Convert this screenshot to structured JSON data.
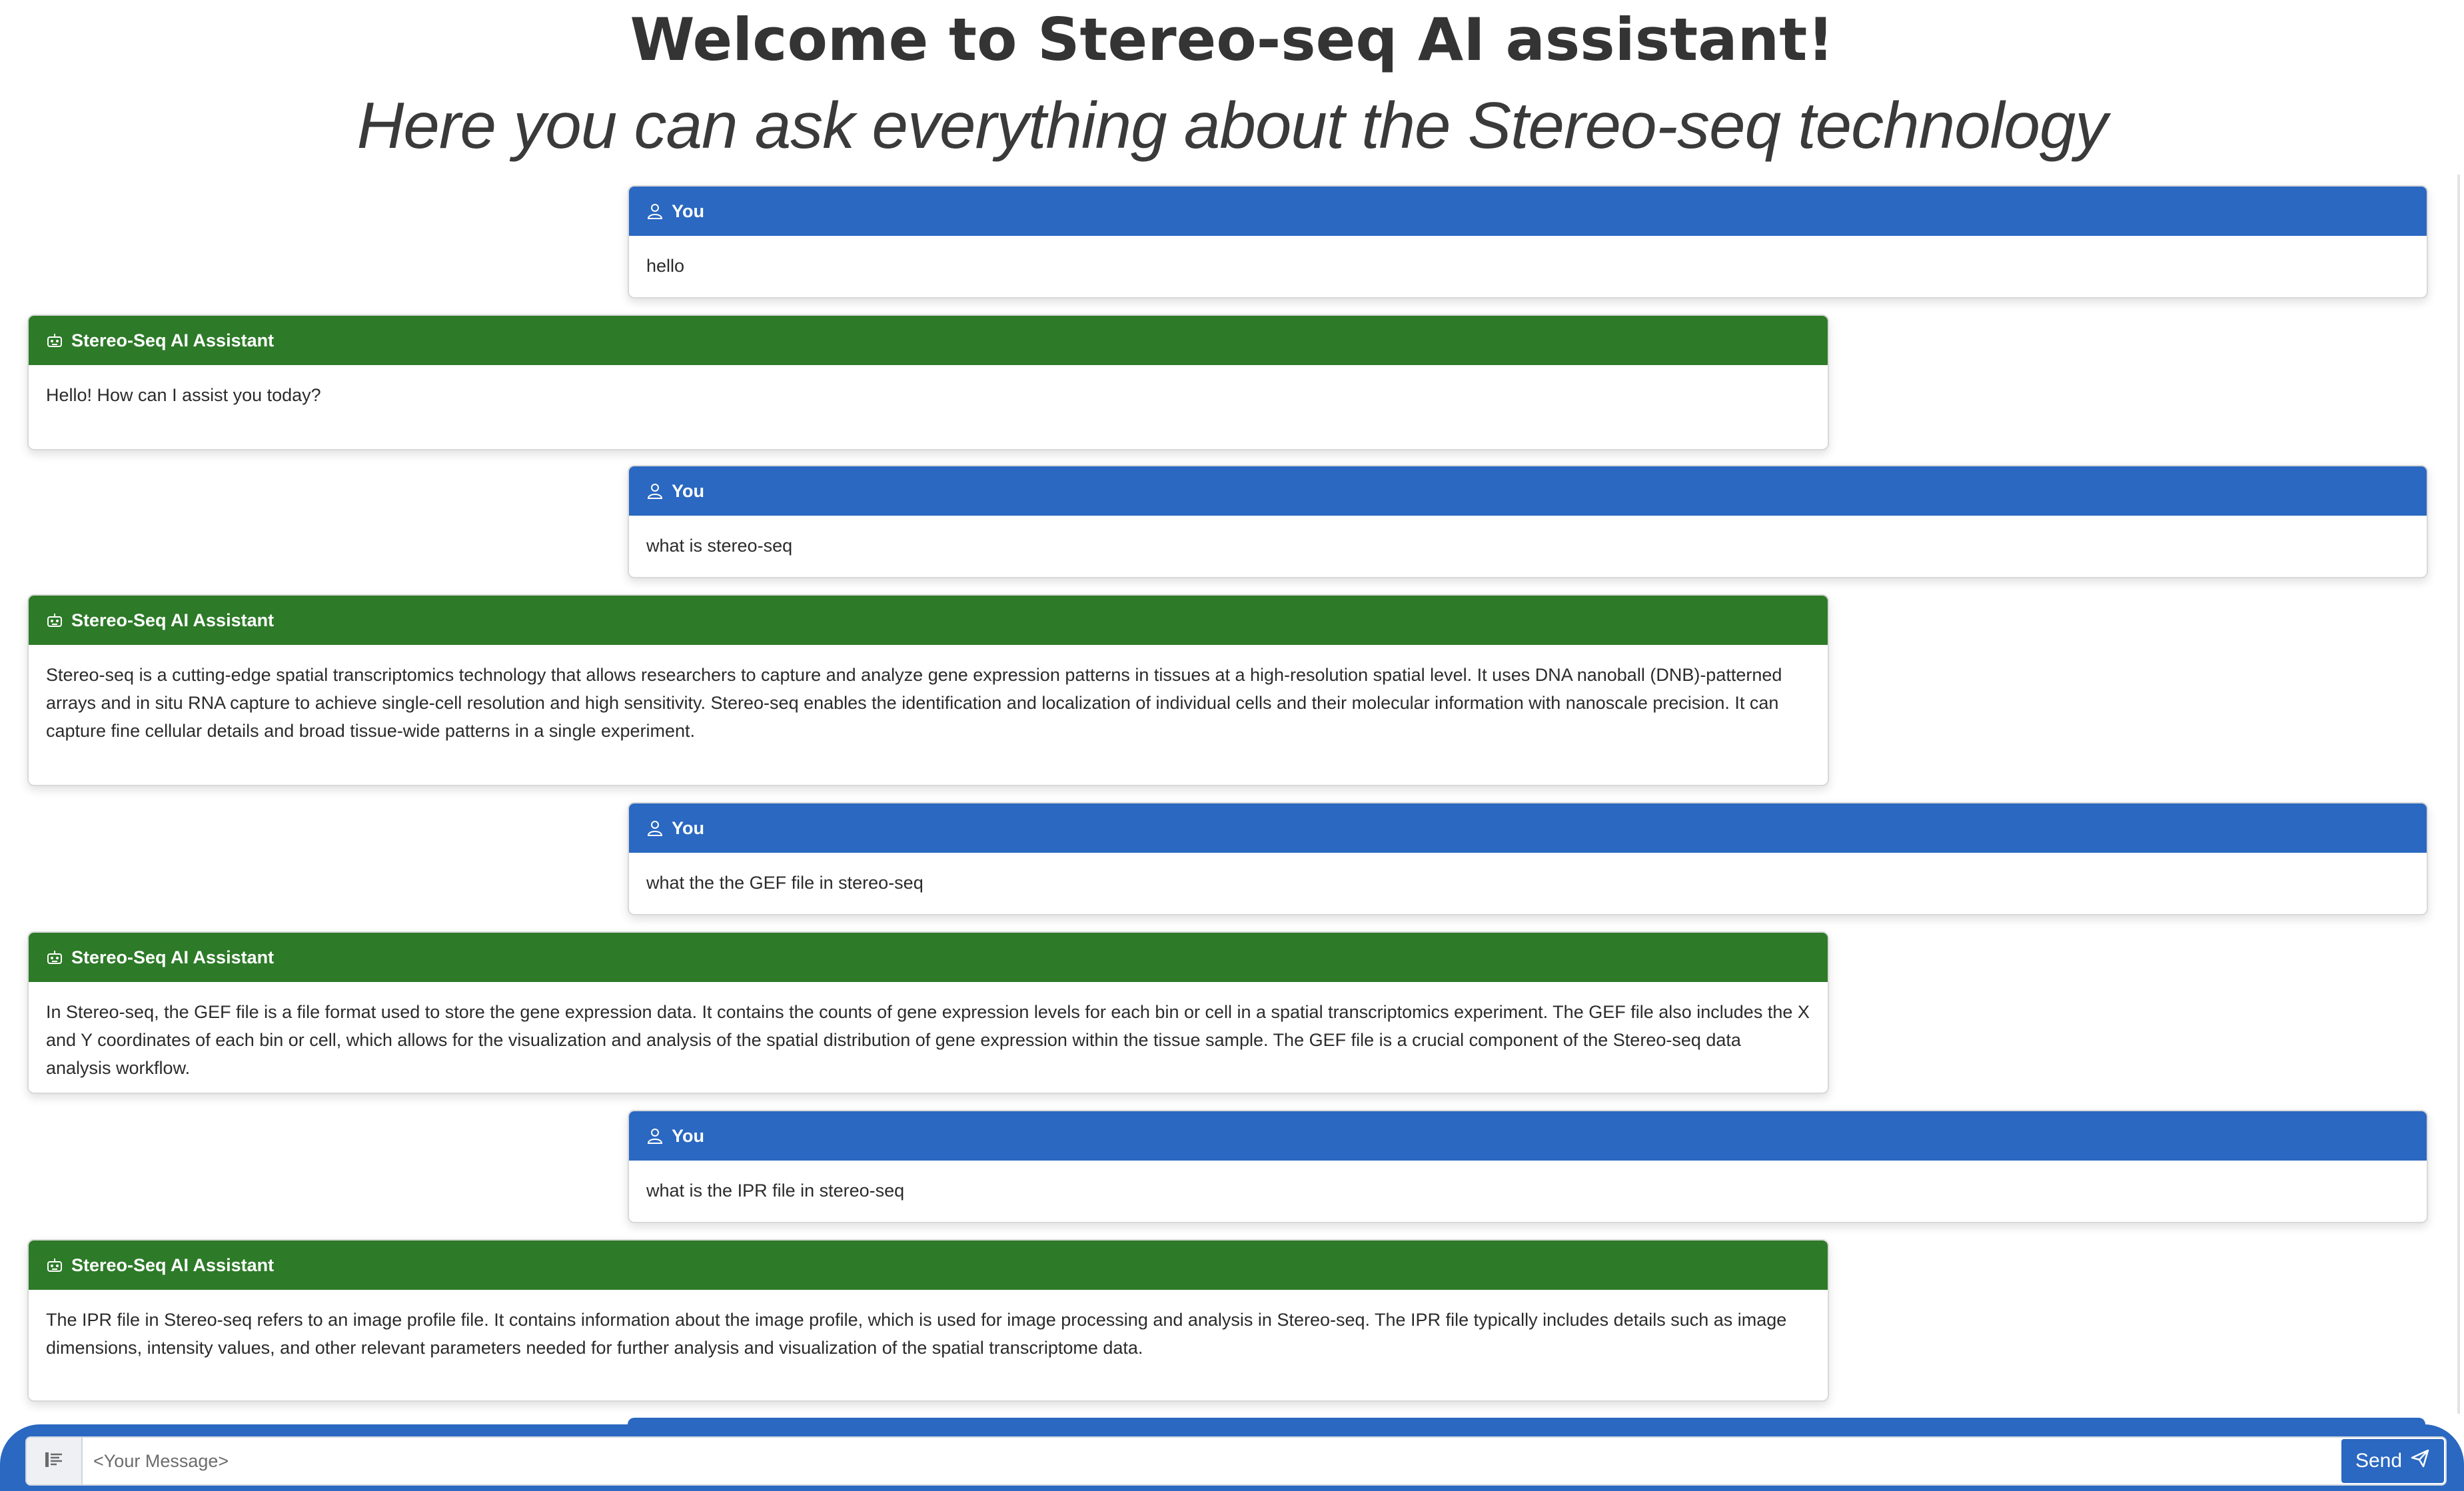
{
  "header": {
    "title": "Welcome to Stereo-seq AI assistant!",
    "subtitle": "Here you can ask everything about the Stereo-seq technology"
  },
  "messages": [
    {
      "role": "user",
      "sender": "You",
      "text": "hello"
    },
    {
      "role": "assistant",
      "sender": "Stereo-Seq AI Assistant",
      "text": "Hello! How can I assist you today?"
    },
    {
      "role": "user",
      "sender": "You",
      "text": "what is stereo-seq"
    },
    {
      "role": "assistant",
      "sender": "Stereo-Seq AI Assistant",
      "text": "Stereo-seq is a cutting-edge spatial transcriptomics technology that allows researchers to capture and analyze gene expression patterns in tissues at a high-resolution spatial level. It uses DNA nanoball (DNB)-patterned arrays and in situ RNA capture to achieve single-cell resolution and high sensitivity. Stereo-seq enables the identification and localization of individual cells and their molecular information with nanoscale precision. It can capture fine cellular details and broad tissue-wide patterns in a single experiment."
    },
    {
      "role": "user",
      "sender": "You",
      "text": "what the the GEF file in stereo-seq"
    },
    {
      "role": "assistant",
      "sender": "Stereo-Seq AI Assistant",
      "text": "In Stereo-seq, the GEF file is a file format used to store the gene expression data. It contains the counts of gene expression levels for each bin or cell in a spatial transcriptomics experiment. The GEF file also includes the X and Y coordinates of each bin or cell, which allows for the visualization and analysis of the spatial distribution of gene expression within the tissue sample. The GEF file is a crucial component of the Stereo-seq data analysis workflow."
    },
    {
      "role": "user",
      "sender": "You",
      "text": "what is the IPR file in stereo-seq"
    },
    {
      "role": "assistant",
      "sender": "Stereo-Seq AI Assistant",
      "text": "The IPR file in Stereo-seq refers to an image profile file. It contains information about the image profile, which is used for image processing and analysis in Stereo-seq. The IPR file typically includes details such as image dimensions, intensity values, and other relevant parameters needed for further analysis and visualization of the spatial transcriptome data."
    }
  ],
  "composer": {
    "placeholder": "<Your Message>",
    "send_label": "Send"
  },
  "colors": {
    "user_header": "#2a68c1",
    "assistant_header": "#2d7a28"
  },
  "icons": {
    "user": "person-icon",
    "assistant": "robot-icon",
    "attach": "attach-icon",
    "send": "send-icon"
  }
}
